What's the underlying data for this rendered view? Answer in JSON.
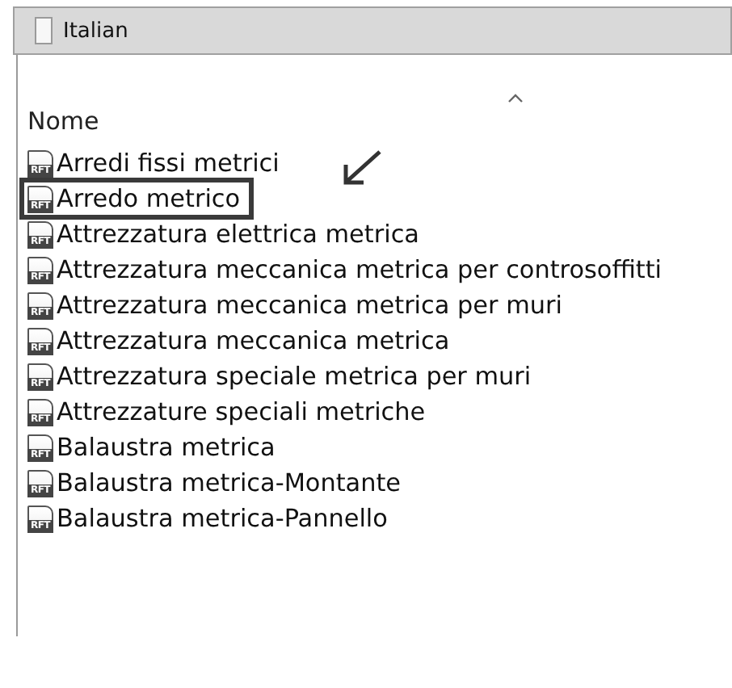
{
  "address_bar": {
    "path": "Italian"
  },
  "column_header": {
    "label": "Nome",
    "sort_ascending": true
  },
  "files": [
    {
      "name": "Arredi fissi metrici",
      "icon_label": "RFT",
      "highlighted": false
    },
    {
      "name": "Arredo metrico",
      "icon_label": "RFT",
      "highlighted": true
    },
    {
      "name": "Attrezzatura elettrica metrica",
      "icon_label": "RFT",
      "highlighted": false
    },
    {
      "name": "Attrezzatura meccanica metrica per controsoffitti",
      "icon_label": "RFT",
      "highlighted": false
    },
    {
      "name": "Attrezzatura meccanica metrica per muri",
      "icon_label": "RFT",
      "highlighted": false
    },
    {
      "name": "Attrezzatura meccanica metrica",
      "icon_label": "RFT",
      "highlighted": false
    },
    {
      "name": "Attrezzatura speciale metrica per muri",
      "icon_label": "RFT",
      "highlighted": false
    },
    {
      "name": "Attrezzature speciali metriche",
      "icon_label": "RFT",
      "highlighted": false
    },
    {
      "name": "Balaustra metrica",
      "icon_label": "RFT",
      "highlighted": false
    },
    {
      "name": "Balaustra metrica-Montante",
      "icon_label": "RFT",
      "highlighted": false
    },
    {
      "name": "Balaustra metrica-Pannello",
      "icon_label": "RFT",
      "highlighted": false
    }
  ]
}
